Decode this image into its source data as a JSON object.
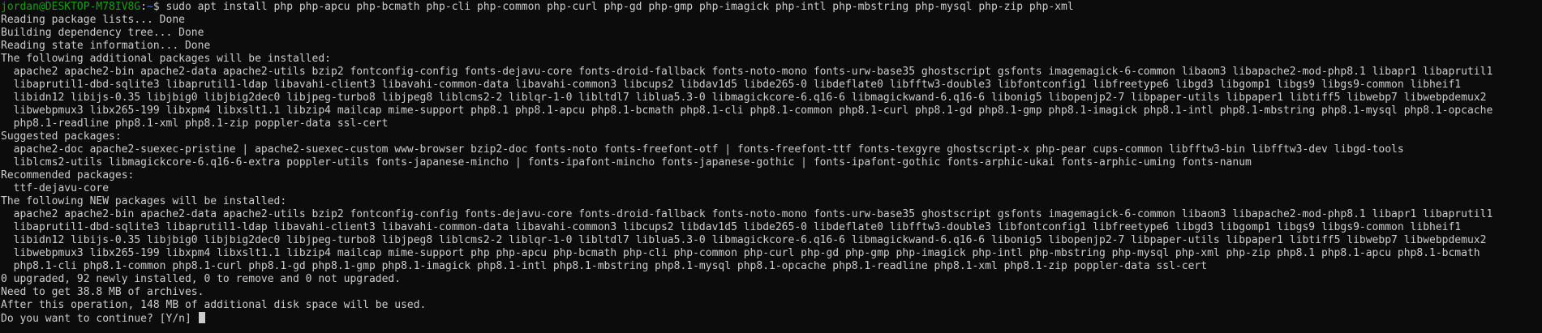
{
  "prompt": {
    "user_host": "jordan@DESKTOP-M78IV8G",
    "separator": ":",
    "path": "~",
    "symbol": "$ ",
    "command": "sudo apt install php php-apcu php-bcmath php-cli php-common php-curl php-gd php-gmp php-imagick php-intl php-mbstring php-mysql php-zip php-xml"
  },
  "output_lines": [
    "Reading package lists... Done",
    "Building dependency tree... Done",
    "Reading state information... Done",
    "The following additional packages will be installed:",
    "  apache2 apache2-bin apache2-data apache2-utils bzip2 fontconfig-config fonts-dejavu-core fonts-droid-fallback fonts-noto-mono fonts-urw-base35 ghostscript gsfonts imagemagick-6-common libaom3 libapache2-mod-php8.1 libapr1 libaprutil1",
    "  libaprutil1-dbd-sqlite3 libaprutil1-ldap libavahi-client3 libavahi-common-data libavahi-common3 libcups2 libdav1d5 libde265-0 libdeflate0 libfftw3-double3 libfontconfig1 libfreetype6 libgd3 libgomp1 libgs9 libgs9-common libheif1",
    "  libidn12 libijs-0.35 libjbig0 libjbig2dec0 libjpeg-turbo8 libjpeg8 liblcms2-2 liblqr-1-0 libltdl7 liblua5.3-0 libmagickcore-6.q16-6 libmagickwand-6.q16-6 libonig5 libopenjp2-7 libpaper-utils libpaper1 libtiff5 libwebp7 libwebpdemux2",
    "  libwebpmux3 libx265-199 libxpm4 libxslt1.1 libzip4 mailcap mime-support php8.1 php8.1-apcu php8.1-bcmath php8.1-cli php8.1-common php8.1-curl php8.1-gd php8.1-gmp php8.1-imagick php8.1-intl php8.1-mbstring php8.1-mysql php8.1-opcache",
    "  php8.1-readline php8.1-xml php8.1-zip poppler-data ssl-cert",
    "Suggested packages:",
    "  apache2-doc apache2-suexec-pristine | apache2-suexec-custom www-browser bzip2-doc fonts-noto fonts-freefont-otf | fonts-freefont-ttf fonts-texgyre ghostscript-x php-pear cups-common libfftw3-bin libfftw3-dev libgd-tools",
    "  liblcms2-utils libmagickcore-6.q16-6-extra poppler-utils fonts-japanese-mincho | fonts-ipafont-mincho fonts-japanese-gothic | fonts-ipafont-gothic fonts-arphic-ukai fonts-arphic-uming fonts-nanum",
    "Recommended packages:",
    "  ttf-dejavu-core",
    "The following NEW packages will be installed:",
    "  apache2 apache2-bin apache2-data apache2-utils bzip2 fontconfig-config fonts-dejavu-core fonts-droid-fallback fonts-noto-mono fonts-urw-base35 ghostscript gsfonts imagemagick-6-common libaom3 libapache2-mod-php8.1 libapr1 libaprutil1",
    "  libaprutil1-dbd-sqlite3 libaprutil1-ldap libavahi-client3 libavahi-common-data libavahi-common3 libcups2 libdav1d5 libde265-0 libdeflate0 libfftw3-double3 libfontconfig1 libfreetype6 libgd3 libgomp1 libgs9 libgs9-common libheif1",
    "  libidn12 libijs-0.35 libjbig0 libjbig2dec0 libjpeg-turbo8 libjpeg8 liblcms2-2 liblqr-1-0 libltdl7 liblua5.3-0 libmagickcore-6.q16-6 libmagickwand-6.q16-6 libonig5 libopenjp2-7 libpaper-utils libpaper1 libtiff5 libwebp7 libwebpdemux2",
    "  libwebpmux3 libx265-199 libxpm4 libxslt1.1 libzip4 mailcap mime-support php php-apcu php-bcmath php-cli php-common php-curl php-gd php-gmp php-imagick php-intl php-mbstring php-mysql php-xml php-zip php8.1 php8.1-apcu php8.1-bcmath",
    "  php8.1-cli php8.1-common php8.1-curl php8.1-gd php8.1-gmp php8.1-imagick php8.1-intl php8.1-mbstring php8.1-mysql php8.1-opcache php8.1-readline php8.1-xml php8.1-zip poppler-data ssl-cert",
    "0 upgraded, 92 newly installed, 0 to remove and 0 not upgraded.",
    "Need to get 38.8 MB of archives.",
    "After this operation, 148 MB of additional disk space will be used.",
    "Do you want to continue? [Y/n] "
  ],
  "colors": {
    "background": "#0c0c0c",
    "foreground": "#cccccc",
    "prompt_user": "#13a10e",
    "prompt_path": "#3b78ff"
  }
}
